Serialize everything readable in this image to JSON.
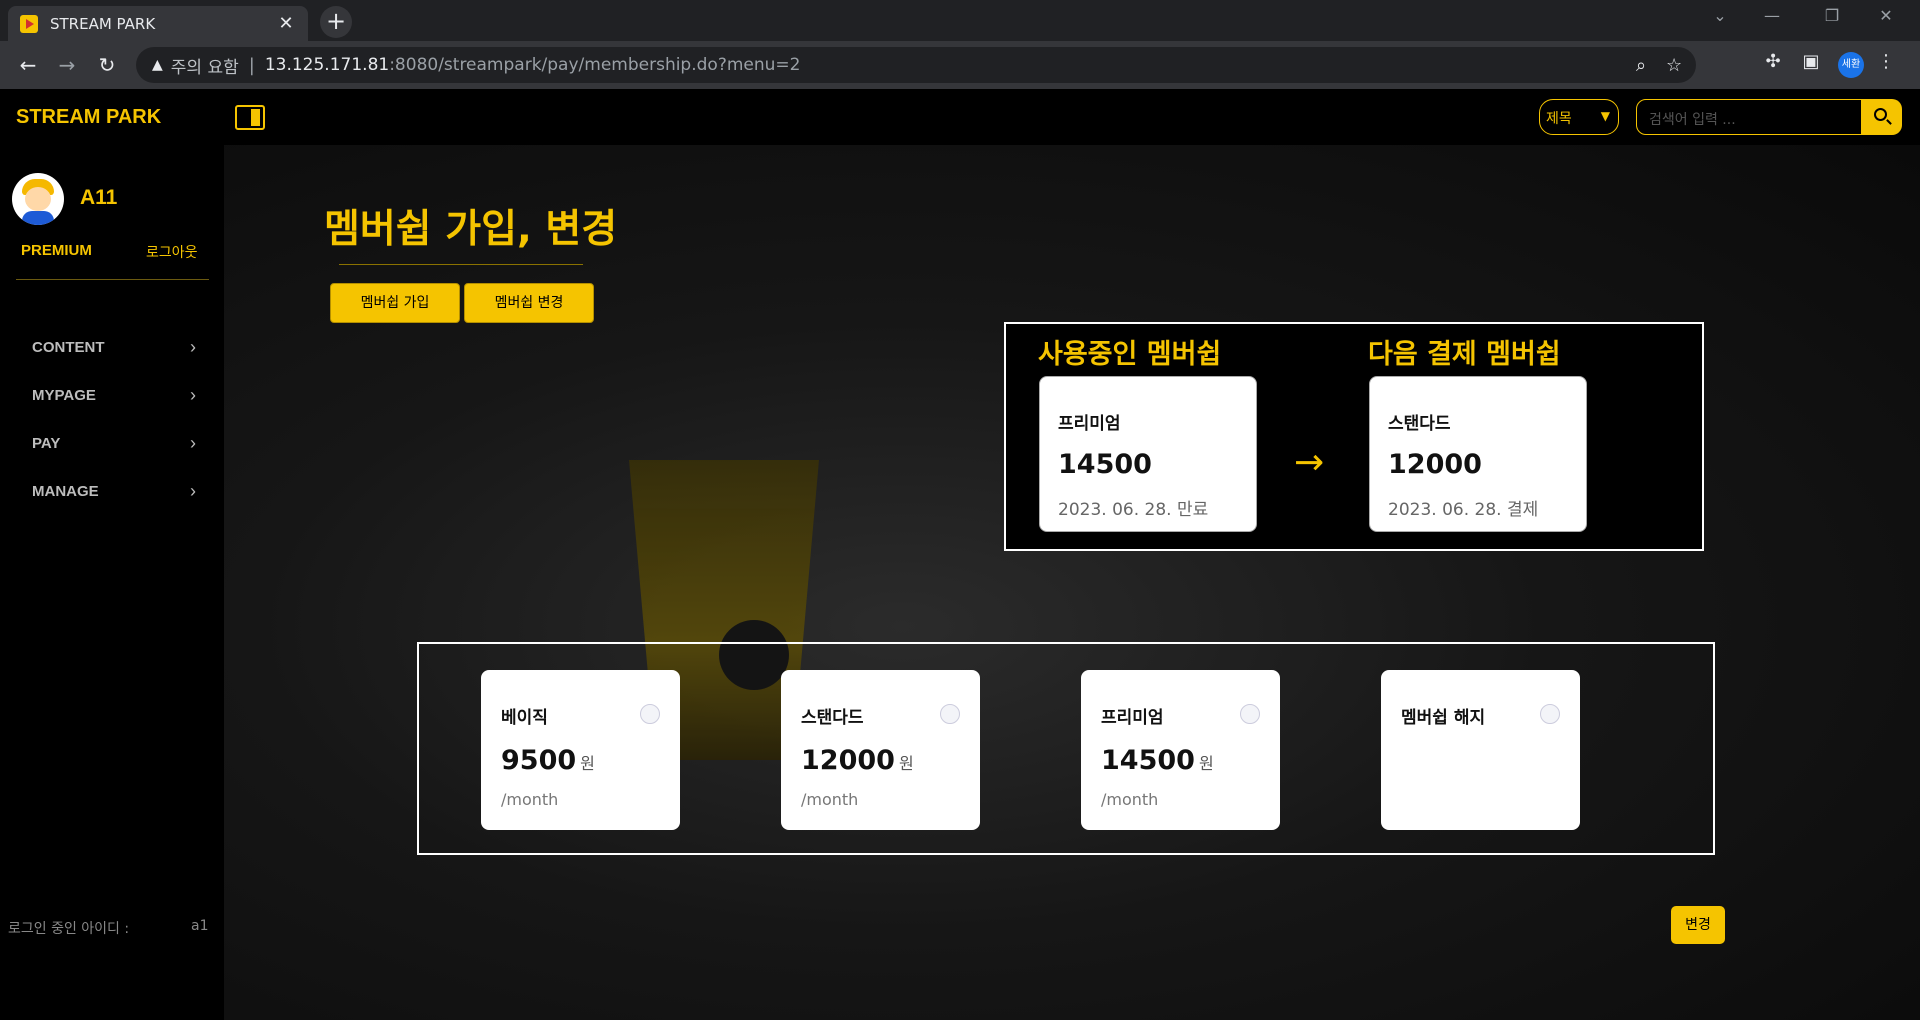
{
  "browser": {
    "tab_title": "STREAM PARK",
    "tab_close": "✕",
    "new_tab": "+",
    "security_warning": "주의 요함",
    "url_host": "13.125.171.81",
    "url_rest": ":8080/streampark/pay/membership.do?menu=2",
    "profile_label": "세환",
    "window_controls": [
      "⌄",
      "—",
      "❐",
      "✕"
    ]
  },
  "header": {
    "logo": "STREAM PARK",
    "search_select": "제목",
    "search_placeholder": "검색어 입력 ..."
  },
  "sidebar": {
    "username": "A11",
    "grade": "PREMIUM",
    "logout": "로그아웃",
    "menu": [
      {
        "label": "CONTENT"
      },
      {
        "label": "MYPAGE"
      },
      {
        "label": "PAY"
      },
      {
        "label": "MANAGE"
      }
    ],
    "login_id_label": "로그인 중인 아이디 :",
    "login_id_value": "a1"
  },
  "page": {
    "title": "멤버쉽 가입, 변경",
    "tabs": [
      {
        "label": "멤버쉽 가입"
      },
      {
        "label": "멤버쉽 변경"
      }
    ],
    "current": {
      "heading": "사용중인 멤버쉽",
      "name": "프리미엄",
      "price": "14500",
      "date": "2023. 06. 28. 만료"
    },
    "next": {
      "heading": "다음 결제 멤버쉽",
      "name": "스탠다드",
      "price": "12000",
      "date": "2023. 06. 28. 결제"
    },
    "arrow": "→",
    "plans": [
      {
        "name": "베이직",
        "price": "9500",
        "unit": "원",
        "period": "/month"
      },
      {
        "name": "스탠다드",
        "price": "12000",
        "unit": "원",
        "period": "/month"
      },
      {
        "name": "프리미엄",
        "price": "14500",
        "unit": "원",
        "period": "/month"
      },
      {
        "name": "멤버쉽 해지",
        "price": "",
        "unit": "",
        "period": ""
      }
    ],
    "change_button": "변경"
  },
  "colors": {
    "accent": "#f5c400",
    "background": "#000000"
  }
}
